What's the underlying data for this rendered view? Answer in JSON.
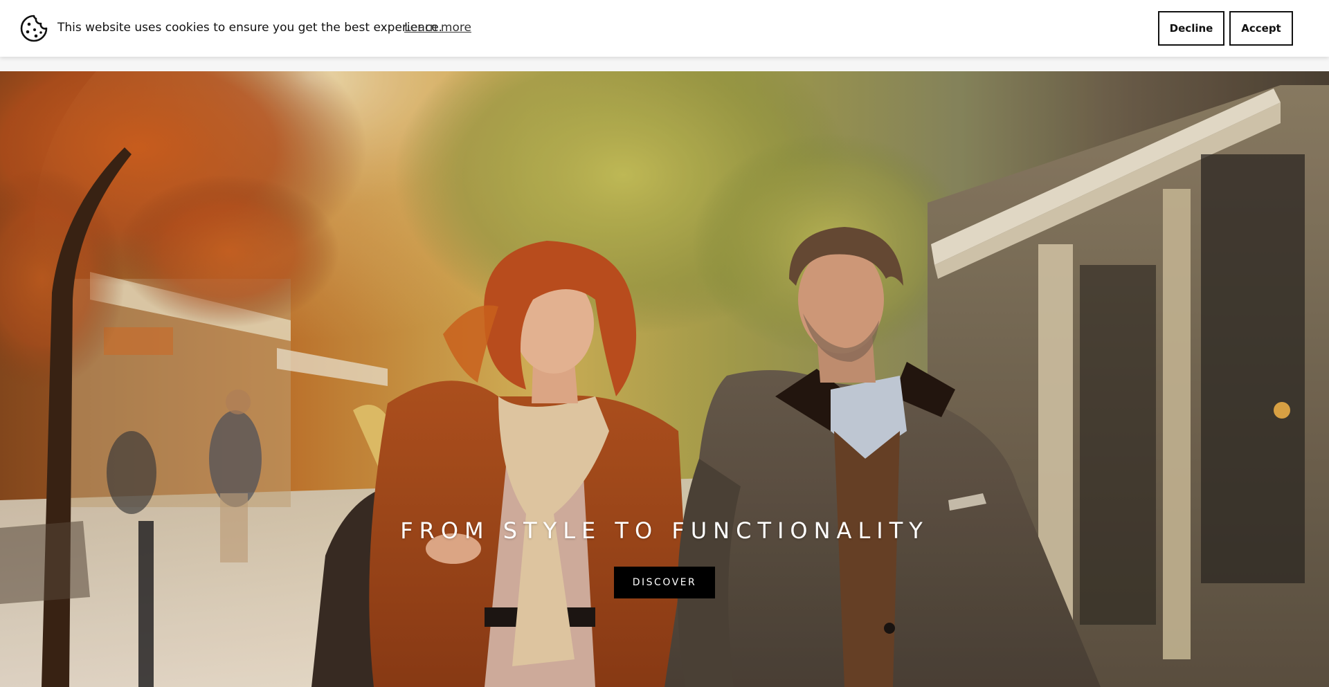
{
  "cookie_banner": {
    "message": "This website uses cookies to ensure you get the best experience.",
    "learn_more": "Learn more",
    "decline_label": "Decline",
    "accept_label": "Accept",
    "icon": "cookie-icon"
  },
  "hero": {
    "title": "FROM STYLE TO FUNCTIONALITY",
    "cta_label": "DISCOVER",
    "image": "couple-walking-autumn-street-photo"
  },
  "colors": {
    "banner_bg": "#ffffff",
    "button_border": "#111111",
    "cta_bg": "#000000",
    "cta_text": "#ffffff"
  }
}
